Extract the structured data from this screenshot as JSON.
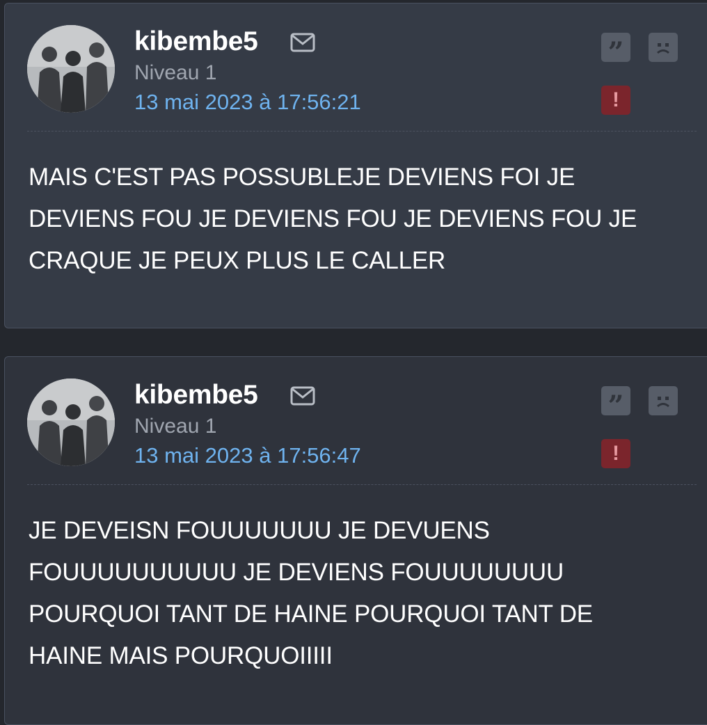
{
  "posts": [
    {
      "username": "kibembe5",
      "level": "Niveau 1",
      "date": "13 mai 2023 à 17:56:21",
      "body_lines": [
        "MAIS C'EST PAS POSSUBLEJE DEVIENS FOI JE",
        "DEVIENS FOU JE DEVIENS FOU JE DEVIENS FOU JE",
        "CRAQUE JE PEUX PLUS LE CALLER"
      ],
      "icons": {
        "mail": "envelope-icon",
        "quote": "quote-icon",
        "sad": "sad-face-icon",
        "report": "alert-icon"
      }
    },
    {
      "username": "kibembe5",
      "level": "Niveau 1",
      "date": "13 mai 2023 à 17:56:47",
      "body_lines": [
        "JE DEVEISN FOUUUUUUU JE DEVUENS",
        "FOUUUUUUUUUU JE DEVIENS FOUUUUUUUU",
        "POURQUOI TANT DE HAINE POURQUOI TANT DE",
        "HAINE MAIS POURQUOIIIII"
      ],
      "icons": {
        "mail": "envelope-icon",
        "quote": "quote-icon",
        "sad": "sad-face-icon",
        "report": "alert-icon"
      }
    }
  ],
  "colors": {
    "page_background": "#24272d",
    "first_post_background": "#353b46",
    "second_post_background": "#2f333c",
    "username": "#ffffff",
    "level": "#a0a6b0",
    "date_link": "#6fb3ef",
    "report_button": "#7b252c",
    "action_button": "#575d68"
  }
}
